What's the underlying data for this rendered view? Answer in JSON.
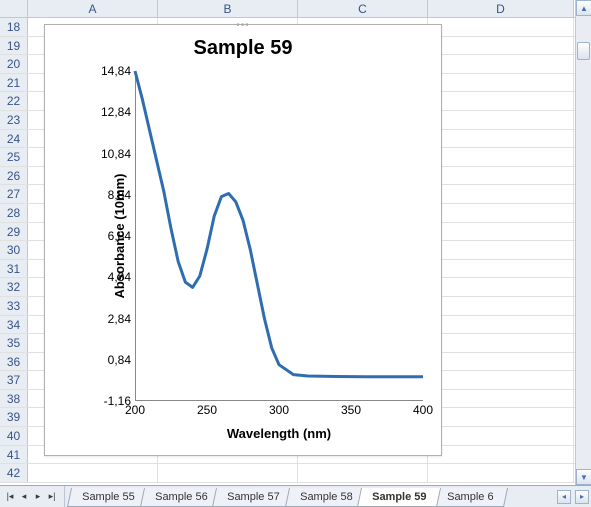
{
  "grid": {
    "columns": [
      "A",
      "B",
      "C",
      "D"
    ],
    "row_start": 18,
    "row_end": 42
  },
  "tabs": {
    "items": [
      {
        "label": "Sample 55",
        "active": false
      },
      {
        "label": "Sample 56",
        "active": false
      },
      {
        "label": "Sample 57",
        "active": false
      },
      {
        "label": "Sample 58",
        "active": false
      },
      {
        "label": "Sample 59",
        "active": true
      },
      {
        "label": "Sample 6",
        "active": false
      }
    ]
  },
  "chart_data": {
    "type": "line",
    "title": "Sample 59",
    "xlabel": "Wavelength (nm)",
    "ylabel": "Absorbance (10mm)",
    "xlim": [
      200,
      400
    ],
    "ylim": [
      -1.16,
      14.84
    ],
    "x_ticks": [
      200,
      250,
      300,
      350,
      400
    ],
    "y_ticks": [
      -1.16,
      0.84,
      2.84,
      4.84,
      6.84,
      8.84,
      10.84,
      12.84,
      14.84
    ],
    "y_tick_labels": [
      "-1,16",
      "0,84",
      "2,84",
      "4,84",
      "6,84",
      "8,84",
      "10,84",
      "12,84",
      "14,84"
    ],
    "series": [
      {
        "name": "Absorbance",
        "color": "#2f6db1",
        "x": [
          200,
          205,
          210,
          215,
          220,
          225,
          230,
          235,
          240,
          245,
          250,
          255,
          260,
          265,
          270,
          275,
          280,
          285,
          290,
          295,
          300,
          310,
          320,
          340,
          360,
          380,
          400
        ],
        "y": [
          14.84,
          13.5,
          12.0,
          10.5,
          9.0,
          7.2,
          5.6,
          4.6,
          4.35,
          4.9,
          6.2,
          7.8,
          8.75,
          8.9,
          8.5,
          7.6,
          6.2,
          4.5,
          2.8,
          1.4,
          0.6,
          0.12,
          0.05,
          0.03,
          0.02,
          0.02,
          0.02
        ]
      }
    ]
  }
}
